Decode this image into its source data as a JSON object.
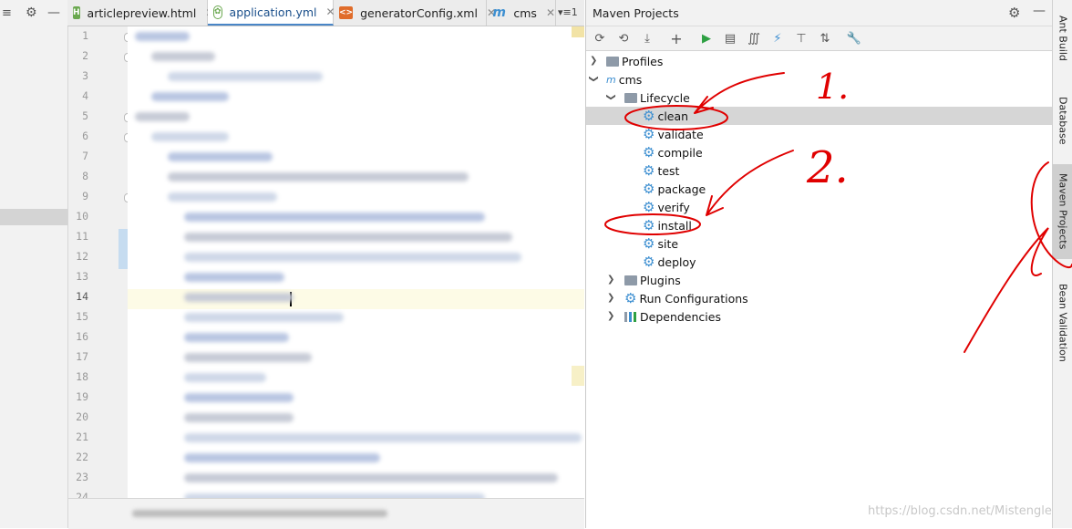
{
  "editor_tabs": [
    {
      "label": "articlepreview.html",
      "icon": "html-file-icon",
      "active": false
    },
    {
      "label": "application.yml",
      "icon": "yaml-file-icon",
      "active": true
    },
    {
      "label": "generatorConfig.xml",
      "icon": "xml-file-icon",
      "active": false
    },
    {
      "label": "cms",
      "icon": "maven-m-icon",
      "active": false
    }
  ],
  "tab_overflow": "▾≡",
  "tab_overflow_count": "1",
  "line_numbers": [
    "1",
    "2",
    "3",
    "4",
    "5",
    "6",
    "7",
    "8",
    "9",
    "10",
    "11",
    "12",
    "13",
    "14",
    "15",
    "16",
    "17",
    "18",
    "19",
    "20",
    "21",
    "22",
    "23",
    "24"
  ],
  "current_line": "14",
  "maven": {
    "title": "Maven Projects",
    "toolbar_icons": [
      "refresh-icon",
      "reimport-icon",
      "download-icon",
      "add-icon",
      "run-icon",
      "execute-goal-icon",
      "toggle-offline-icon",
      "skip-tests-icon",
      "show-dependencies-icon",
      "collapse-all-icon",
      "settings-wrench-icon"
    ],
    "tree": {
      "profiles": "Profiles",
      "project": "cms",
      "lifecycle": "Lifecycle",
      "phases": [
        "clean",
        "validate",
        "compile",
        "test",
        "package",
        "verify",
        "install",
        "site",
        "deploy"
      ],
      "plugins": "Plugins",
      "run_configurations": "Run Configurations",
      "dependencies": "Dependencies"
    },
    "selected_phase": "clean"
  },
  "right_tool_windows": [
    "Ant Build",
    "Database",
    "Maven Projects",
    "Bean Validation"
  ],
  "annotations": [
    "1.",
    "2."
  ],
  "watermark": "https://blog.csdn.net/Mistengle",
  "colors": {
    "accent_blue": "#3d8fd1",
    "red_annotation": "#e00000",
    "run_green": "#2ea043"
  }
}
